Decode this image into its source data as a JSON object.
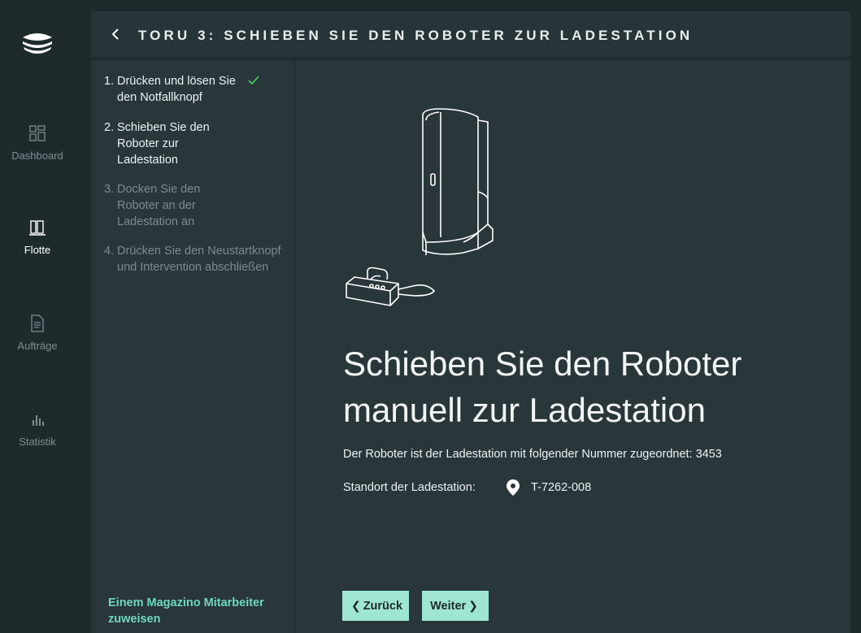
{
  "nav": {
    "items": [
      {
        "label": "Dashboard",
        "icon": "dashboard-icon",
        "active": false
      },
      {
        "label": "Flotte",
        "icon": "fleet-icon",
        "active": true
      },
      {
        "label": "Aufträge",
        "icon": "document-icon",
        "active": false
      },
      {
        "label": "Statistik",
        "icon": "bar-chart-icon",
        "active": false
      }
    ]
  },
  "header": {
    "title": "TORU 3: SCHIEBEN SIE DEN ROBOTER ZUR LADESTATION"
  },
  "steps": [
    {
      "num": "1.",
      "text": "Drücken und lösen Sie den Notfallknopf",
      "state": "done"
    },
    {
      "num": "2.",
      "text": "Schieben Sie den Roboter zur Ladestation",
      "state": "current"
    },
    {
      "num": "3.",
      "text": "Docken Sie den Roboter an der Ladestation an",
      "state": "future"
    },
    {
      "num": "4.",
      "text": "Drücken Sie den Neustartknopf und Intervention abschließen",
      "state": "future"
    }
  ],
  "assign_link": "Einem Magazino Mitarbeiter zuweisen",
  "main": {
    "heading": "Schieben Sie den Roboter manuell zur Ladestation",
    "info": "Der Roboter ist der Ladestation mit folgender Nummer zugeordnet: 3453",
    "location_label": "Standort der Ladestation:",
    "location_value": "T-7262-008"
  },
  "buttons": {
    "back": "Zurück",
    "next": "Weiter"
  },
  "colors": {
    "accent": "#9ee6d2",
    "link": "#6fd8bf",
    "check": "#4cd964",
    "background": "#29363a"
  }
}
